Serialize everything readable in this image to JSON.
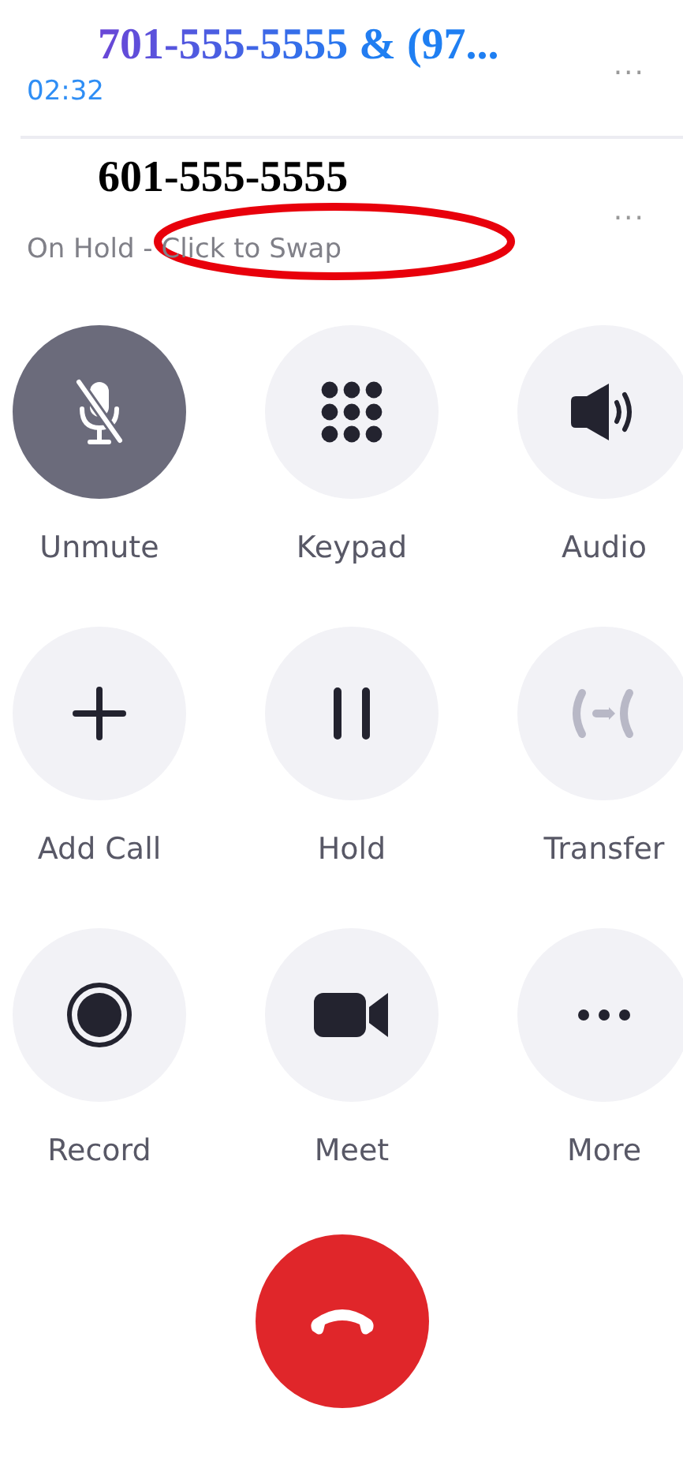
{
  "calls": [
    {
      "kind": "active",
      "title": "701-555-5555 & (97...",
      "status": "02:32",
      "menu": "...",
      "circled": false
    },
    {
      "kind": "held",
      "title": "601-555-5555",
      "status": "On Hold - Click to Swap",
      "menu": "...",
      "circled": true
    }
  ],
  "actions": [
    {
      "kind": "mute",
      "label": "Unmute",
      "on": true,
      "disabled": false
    },
    {
      "kind": "keypad",
      "label": "Keypad",
      "on": false,
      "disabled": false
    },
    {
      "kind": "audio",
      "label": "Audio",
      "on": false,
      "disabled": false
    },
    {
      "kind": "add",
      "label": "Add Call",
      "on": false,
      "disabled": false
    },
    {
      "kind": "hold",
      "label": "Hold",
      "on": false,
      "disabled": false
    },
    {
      "kind": "transfer",
      "label": "Transfer",
      "on": false,
      "disabled": true
    },
    {
      "kind": "record",
      "label": "Record",
      "on": false,
      "disabled": false
    },
    {
      "kind": "meet",
      "label": "Meet",
      "on": false,
      "disabled": false
    },
    {
      "kind": "more",
      "label": "More",
      "on": false,
      "disabled": false
    }
  ],
  "end_call": {
    "kind": "hangup"
  }
}
